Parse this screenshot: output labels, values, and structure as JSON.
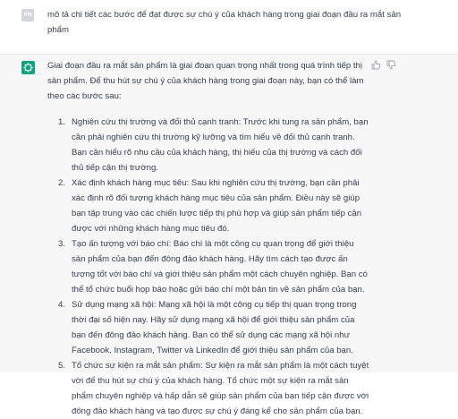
{
  "user": {
    "avatar_initials": "PN",
    "message": "mô tả chi tiết các bước để đạt được sự chú ý của khách hàng trong giai đoạn đầu ra mắt sản phẩm"
  },
  "assistant": {
    "avatar_icon": "openai-logo-icon",
    "intro": "Giai đoạn đầu ra mắt sản phẩm là giai đoạn quan trọng nhất trong quá trình tiếp thị sản phẩm. Để thu hút sự chú ý của khách hàng trong giai đoạn này, bạn có thể làm theo các bước sau:",
    "steps": [
      {
        "number": "1.",
        "text": "Nghiên cứu thị trường và đối thủ cạnh tranh: Trước khi tung ra sản phẩm, bạn cần phải nghiên cứu thị trường kỹ lưỡng và tìm hiểu về đối thủ cạnh tranh. Bạn cần hiểu rõ nhu cầu của khách hàng, thị hiếu của thị trường và cách đối thủ tiếp cận thị trường."
      },
      {
        "number": "2.",
        "text": "Xác định khách hàng mục tiêu: Sau khi nghiên cứu thị trường, bạn cần phải xác định rõ đối tượng khách hàng mục tiêu của sản phẩm. Điều này sẽ giúp bạn tập trung vào các chiến lược tiếp thị phù hợp và giúp sản phẩm tiếp cận được với những khách hàng mục tiêu đó."
      },
      {
        "number": "3.",
        "text": "Tạo ấn tượng với báo chí: Báo chí là một công cụ quan trọng để giới thiệu sản phẩm của bạn đến đông đảo khách hàng. Hãy tìm cách tạo được ấn tượng tốt với báo chí và giới thiệu sản phẩm một cách chuyên nghiệp. Bạn có thể tổ chức buổi họp báo hoặc gửi báo chí một bản tin về sản phẩm của bạn."
      },
      {
        "number": "4.",
        "text": "Sử dụng mạng xã hội: Mạng xã hội là một công cụ tiếp thị quan trọng trong thời đại số hiện nay. Hãy sử dụng mạng xã hội để giới thiệu sản phẩm của bạn đến đông đảo khách hàng. Bạn có thể sử dụng các mạng xã hội như Facebook, Instagram, Twitter và LinkedIn để giới thiệu sản phẩm của bạn."
      },
      {
        "number": "5.",
        "text": "Tổ chức sự kiện ra mắt sản phẩm: Sự kiện ra mắt sản phẩm là một cách tuyệt vời để thu hút sự chú ý của khách hàng. Tổ chức một sự kiện ra mắt sản phẩm chuyên nghiệp và hấp dẫn sẽ giúp sản phẩm của bạn tiếp cận được với đông đảo khách hàng và tạo được sự chú ý đáng kể cho sản phẩm của bạn."
      }
    ],
    "feedback": {
      "like_icon": "thumbs-up-icon",
      "dislike_icon": "thumbs-down-icon"
    }
  },
  "colors": {
    "text": "#374151",
    "user_avatar": "#d1d5db",
    "assistant_avatar": "#10a37f",
    "assistant_bg": "#f7f7f8"
  }
}
